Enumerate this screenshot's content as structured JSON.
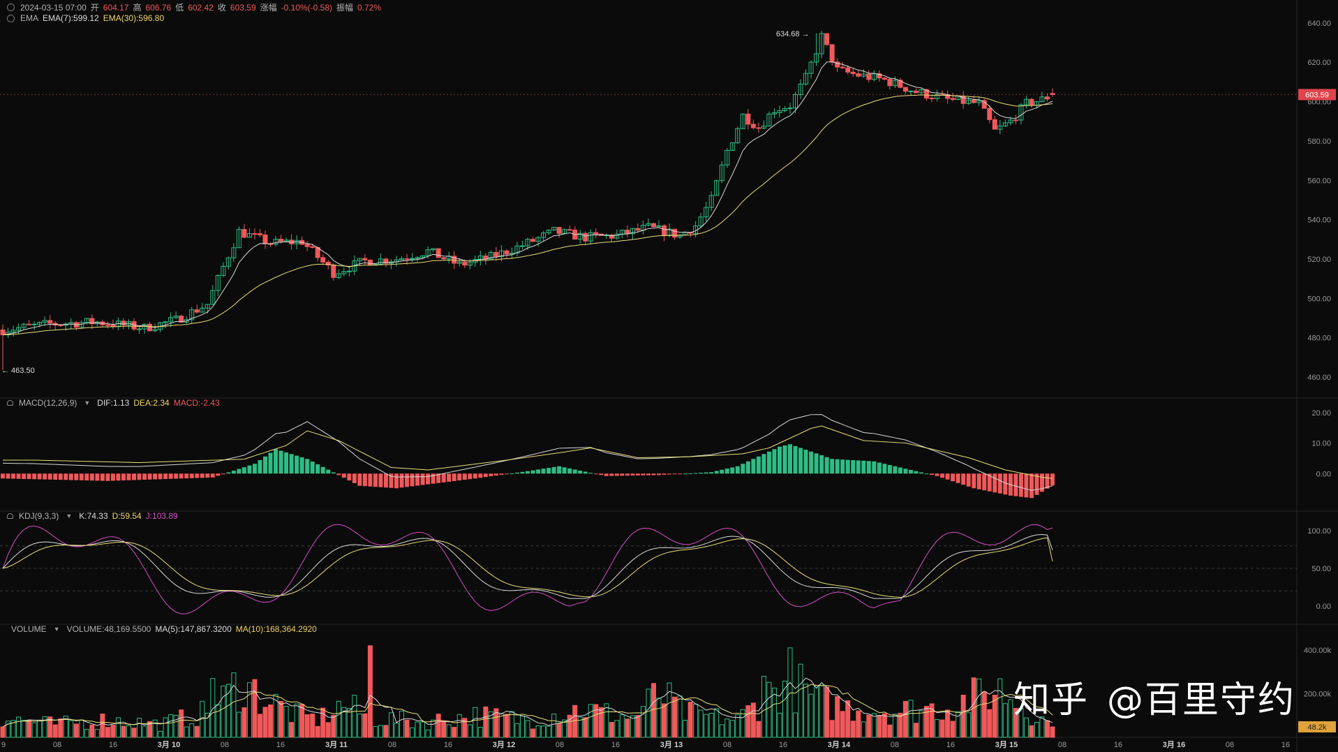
{
  "symbol_bar": {
    "datetime": "2024-03-15 07:00",
    "open_label": "开",
    "open": "604.17",
    "high_label": "高",
    "high": "606.76",
    "low_label": "低",
    "low": "602.42",
    "close_label": "收",
    "close": "603.59",
    "change_label": "涨幅",
    "change": "-0.10%(-0.58)",
    "amp_label": "振幅",
    "amp": "0.72%"
  },
  "ema_legend": {
    "name": "EMA",
    "ema7": "EMA(7):599.12",
    "ema30": "EMA(30):596.80"
  },
  "macd_legend": {
    "name": "MACD(12,26,9)",
    "dif": "DIF:1.13",
    "dea": "DEA:2.34",
    "macd": "MACD:-2.43"
  },
  "kdj_legend": {
    "name": "KDJ(9,3,3)",
    "k": "K:74.33",
    "d": "D:59.54",
    "j": "J:103.89"
  },
  "volume_legend": {
    "name": "VOLUME",
    "vol": "VOLUME:48,169.5500",
    "ma5": "MA(5):147,867.3200",
    "ma10": "MA(10):168,364.2920"
  },
  "watermark": {
    "logo": "知乎",
    "handle": "@百里守约"
  },
  "colors": {
    "up": "#2ebd85",
    "down": "#f0585a",
    "ema7": "#d9d9d9",
    "ema30": "#e8df7a",
    "dif": "#d9d9d9",
    "dea": "#e8df7a",
    "k": "#d9d9d9",
    "d": "#e8df7a",
    "j": "#d64fc7",
    "background": "#0b0b0b",
    "grid": "#1d1d1d"
  },
  "chart_data": {
    "type": "candlestick",
    "interval": "1h",
    "price_axis": {
      "ticks": [
        "640.00",
        "620.00",
        "600.00",
        "580.00",
        "560.00",
        "540.00",
        "520.00",
        "500.00",
        "480.00",
        "460.00"
      ],
      "range": [
        454,
        641
      ]
    },
    "last_price_label": "603.59",
    "high_marker": {
      "label": "634.68 →",
      "value": 634.68
    },
    "low_marker": {
      "label": "← 463.50",
      "value": 463.5
    },
    "x_ticks": [
      "9",
      "08",
      "16",
      "3月 10",
      "08",
      "16",
      "3月 11",
      "08",
      "16",
      "3月 12",
      "08",
      "16",
      "3月 13",
      "08",
      "16",
      "3月 14",
      "08",
      "16",
      "3月 15",
      "08",
      "16",
      "3月 16",
      "08",
      "16"
    ],
    "macd_axis": {
      "ticks": [
        "20.00",
        "10.00",
        "0.00"
      ],
      "range": [
        -10,
        22
      ]
    },
    "kdj_axis": {
      "ticks": [
        "100.00",
        "50.00",
        "0.00"
      ],
      "range": [
        -15,
        115
      ],
      "dashed_levels": [
        80,
        50,
        20
      ]
    },
    "volume_axis": {
      "ticks": [
        "400.00k",
        "200.00k"
      ],
      "range": [
        0,
        480000
      ]
    },
    "volume_last_label": "48.2k",
    "price_anchors": [
      [
        0,
        484
      ],
      [
        9,
        487
      ],
      [
        18,
        488
      ],
      [
        27,
        485
      ],
      [
        33,
        489
      ],
      [
        39,
        497
      ],
      [
        42,
        516
      ],
      [
        45,
        534
      ],
      [
        51,
        528
      ],
      [
        57,
        529
      ],
      [
        63,
        513
      ],
      [
        69,
        519
      ],
      [
        75,
        520
      ],
      [
        81,
        524
      ],
      [
        87,
        517
      ],
      [
        93,
        521
      ],
      [
        99,
        527
      ],
      [
        105,
        534
      ],
      [
        111,
        531
      ],
      [
        117,
        532
      ],
      [
        123,
        536
      ],
      [
        129,
        532
      ],
      [
        132,
        537
      ],
      [
        135,
        550
      ],
      [
        138,
        575
      ],
      [
        141,
        593
      ],
      [
        144,
        587
      ],
      [
        147,
        596
      ],
      [
        150,
        598
      ],
      [
        153,
        612
      ],
      [
        156,
        633
      ],
      [
        159,
        616
      ],
      [
        162,
        614
      ],
      [
        168,
        611
      ],
      [
        174,
        605
      ],
      [
        180,
        601
      ],
      [
        186,
        599
      ],
      [
        189,
        585
      ],
      [
        192,
        590
      ],
      [
        195,
        599
      ],
      [
        198,
        601
      ],
      [
        200,
        603.59
      ]
    ],
    "volume_anchors": [
      [
        0,
        90000
      ],
      [
        10,
        60000
      ],
      [
        20,
        80000
      ],
      [
        30,
        60000
      ],
      [
        40,
        120000
      ],
      [
        45,
        250000
      ],
      [
        55,
        110000
      ],
      [
        60,
        80000
      ],
      [
        65,
        150000
      ],
      [
        70,
        90000
      ],
      [
        80,
        70000
      ],
      [
        90,
        100000
      ],
      [
        100,
        80000
      ],
      [
        110,
        130000
      ],
      [
        120,
        90000
      ],
      [
        125,
        200000
      ],
      [
        130,
        110000
      ],
      [
        140,
        80000
      ],
      [
        145,
        180000
      ],
      [
        150,
        260000
      ],
      [
        155,
        170000
      ],
      [
        160,
        140000
      ],
      [
        170,
        120000
      ],
      [
        180,
        140000
      ],
      [
        190,
        220000
      ],
      [
        200,
        48170
      ]
    ],
    "macd_anchors": [
      [
        0,
        -1
      ],
      [
        20,
        -1.5
      ],
      [
        40,
        -0.8
      ],
      [
        48,
        2
      ],
      [
        52,
        5
      ],
      [
        58,
        3
      ],
      [
        68,
        -2.5
      ],
      [
        75,
        -3
      ],
      [
        90,
        -1
      ],
      [
        100,
        0.5
      ],
      [
        106,
        1.5
      ],
      [
        115,
        -0.5
      ],
      [
        125,
        -0.3
      ],
      [
        135,
        0.3
      ],
      [
        140,
        1.5
      ],
      [
        148,
        5.5
      ],
      [
        150,
        6
      ],
      [
        158,
        3
      ],
      [
        166,
        2.5
      ],
      [
        172,
        1
      ],
      [
        178,
        -0.5
      ],
      [
        185,
        -3
      ],
      [
        192,
        -4.5
      ],
      [
        196,
        -5
      ],
      [
        200,
        -2.43
      ]
    ],
    "macd_last": {
      "dif": 1.13,
      "dea": 2.34,
      "hist": -2.43
    },
    "kdj_last": {
      "k": 74.33,
      "d": 59.54,
      "j": 103.89
    }
  }
}
